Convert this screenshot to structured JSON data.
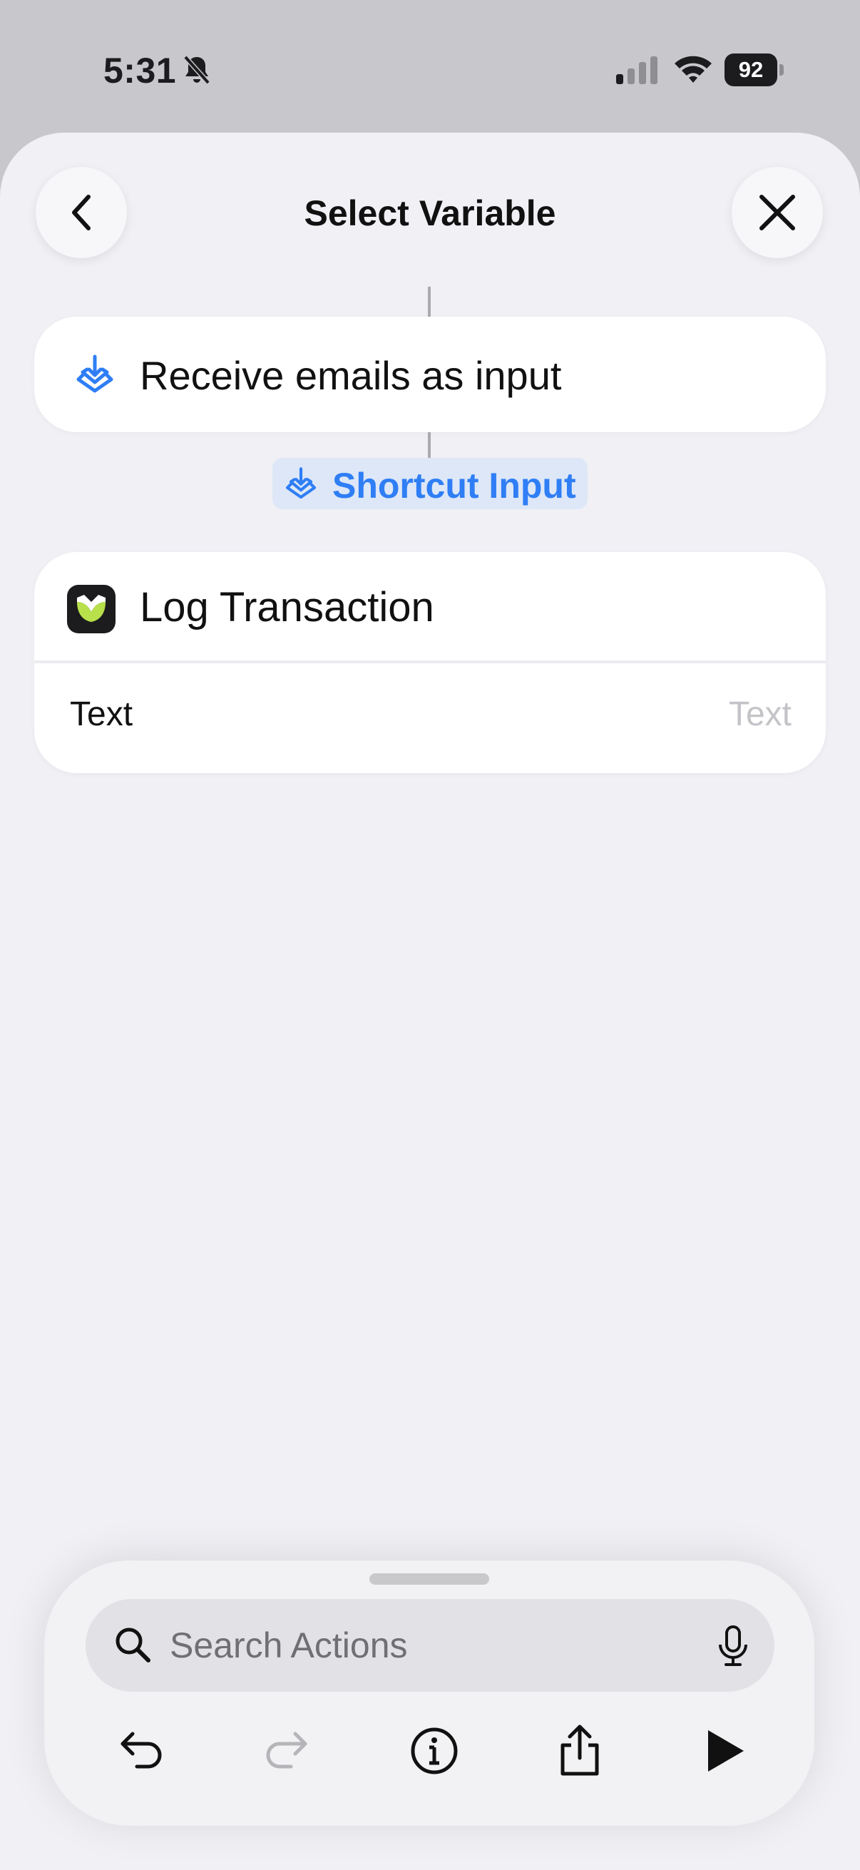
{
  "status_bar": {
    "time": "5:31",
    "battery": "92"
  },
  "header": {
    "title": "Select Variable"
  },
  "trigger": {
    "label": "Receive emails as input"
  },
  "variable": {
    "label": "Shortcut Input"
  },
  "action": {
    "title": "Log Transaction",
    "param_label": "Text",
    "param_placeholder": "Text"
  },
  "search": {
    "placeholder": "Search Actions"
  },
  "colors": {
    "accent": "#2f7ef5",
    "app_green": "#b7e04a",
    "app_icon_bg": "#1c1c1e"
  }
}
